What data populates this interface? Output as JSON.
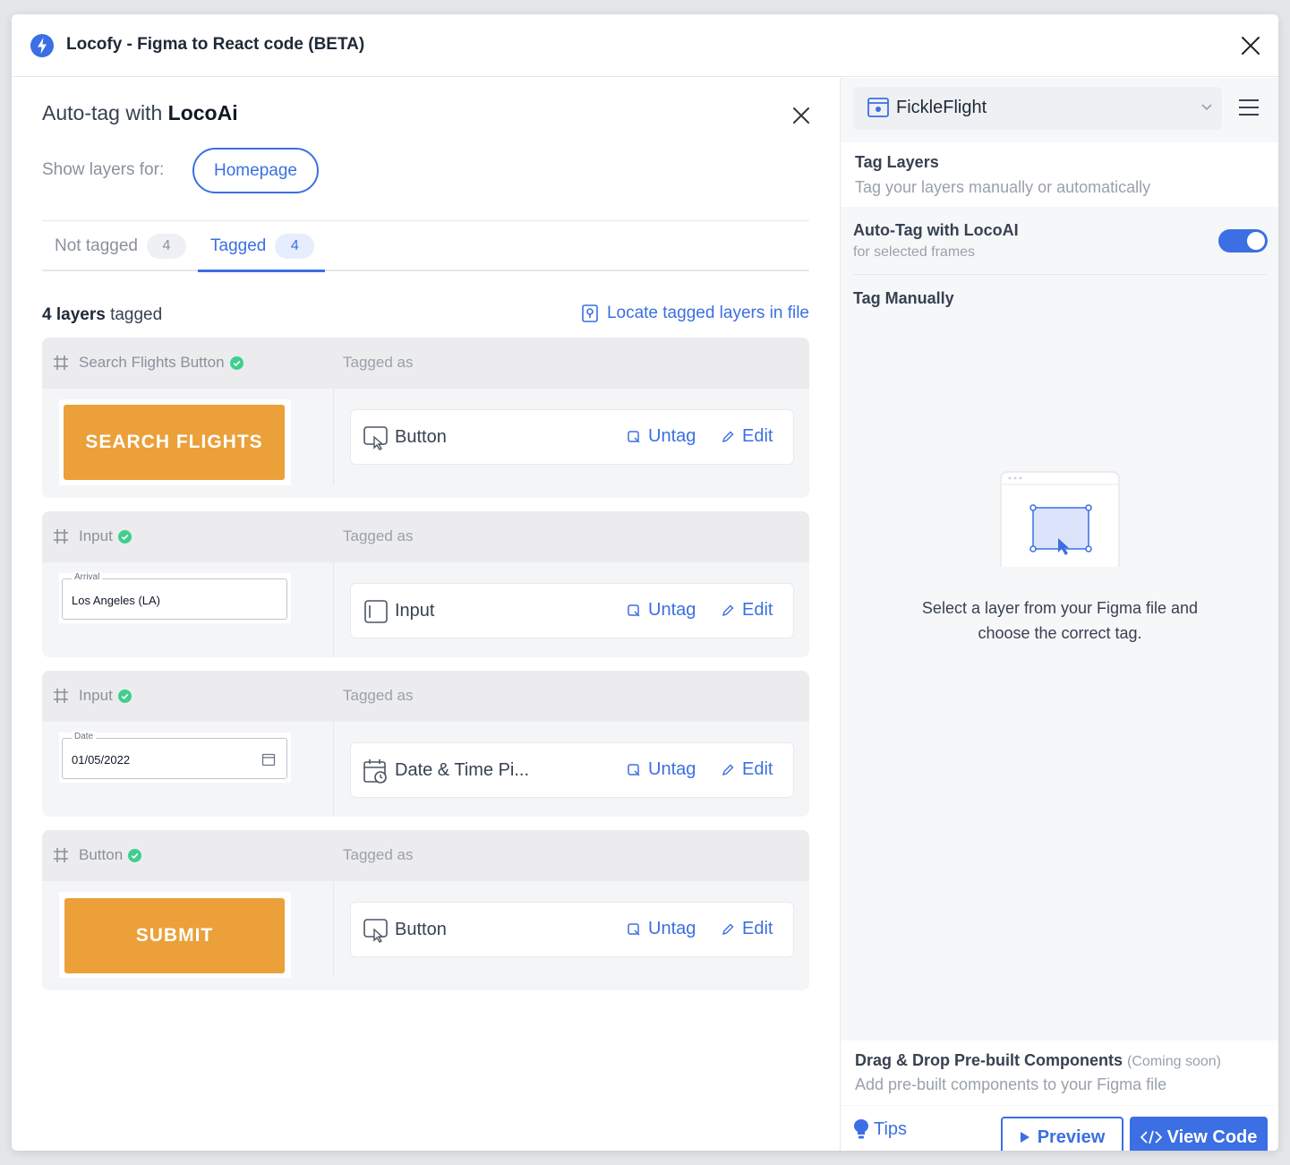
{
  "window": {
    "title": "Locofy - Figma to React code (BETA)"
  },
  "autotag": {
    "title_prefix": "Auto-tag with ",
    "title_bold": "LocoAi",
    "show_layers_label": "Show layers for:",
    "page": "Homepage",
    "tabs": [
      {
        "label": "Not tagged",
        "count": "4"
      },
      {
        "label": "Tagged",
        "count": "4"
      }
    ],
    "active_tab": "Tagged",
    "layers_count_bold": "4 layers",
    "layers_count_rest": " tagged",
    "locate_label": "Locate tagged layers in file",
    "tagged_as_label": "Tagged as",
    "untag_label": "Untag",
    "edit_label": "Edit",
    "cards": [
      {
        "name": "Search Flights Button",
        "tag": "Button",
        "tag_icon": "button-tag-icon",
        "preview_text": "SEARCH FLIGHTS"
      },
      {
        "name": "Input",
        "tag": "Input",
        "tag_icon": "input-tag-icon",
        "preview_label": "Arrival",
        "preview_value": "Los Angeles (LA)"
      },
      {
        "name": "Input",
        "tag": "Date & Time Pi...",
        "tag_icon": "datetime-tag-icon",
        "preview_label": "Date",
        "preview_value": "01/05/2022"
      },
      {
        "name": "Button",
        "tag": "Button",
        "tag_icon": "button-tag-icon",
        "preview_text": "SUBMIT"
      }
    ]
  },
  "sidebar": {
    "project": "FickleFlight",
    "tag_layers_title": "Tag Layers",
    "tag_layers_sub": "Tag your layers manually or automatically",
    "autotag_label": "Auto-Tag with LocoAI",
    "autotag_sub": "for selected frames",
    "autotag_enabled": true,
    "tag_manually": "Tag Manually",
    "empty_message": "Select a layer from your Figma file and choose the correct tag.",
    "dnd_title": "Drag & Drop Pre-built Components",
    "dnd_badge": "(Coming soon)",
    "dnd_sub": "Add pre-built components to your Figma file",
    "tips": "Tips",
    "preview": "Preview",
    "view_code": "View Code"
  },
  "colors": {
    "accent": "#3b6fe3",
    "orange": "#eba03a",
    "success": "#3fcf8e"
  }
}
